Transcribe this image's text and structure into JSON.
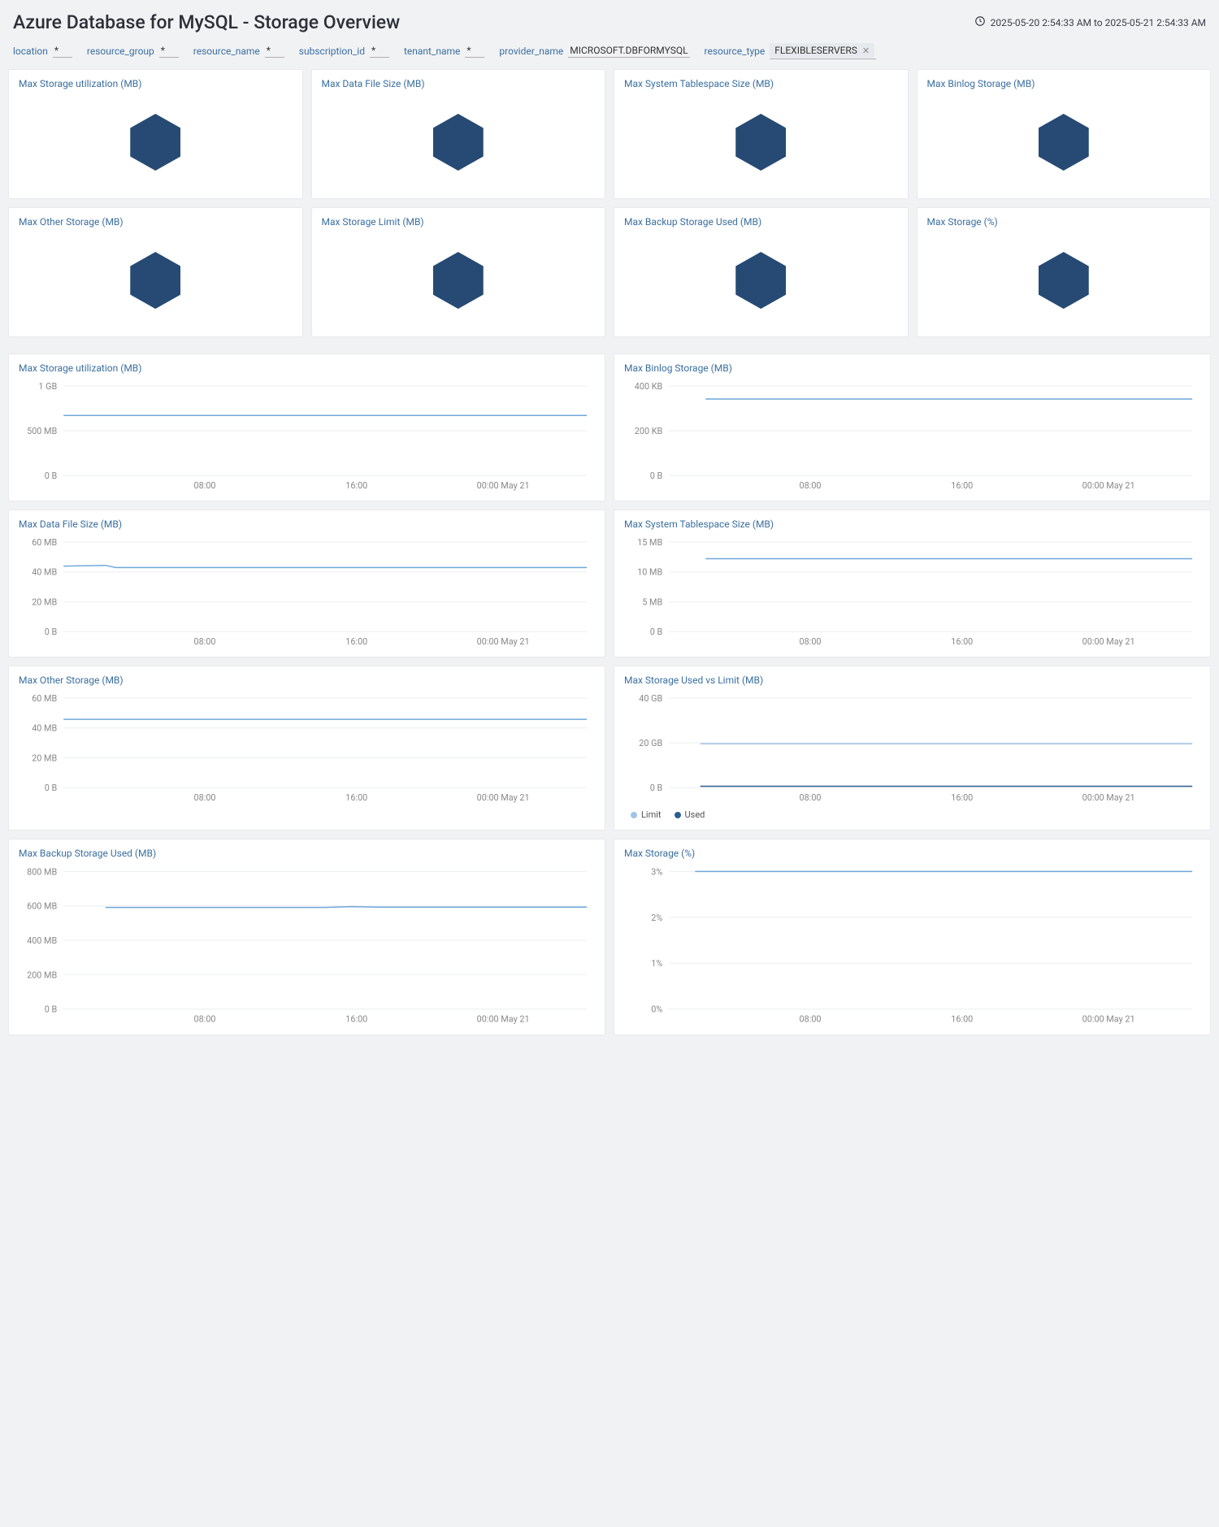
{
  "header": {
    "title": "Azure Database for MySQL - Storage Overview",
    "timerange": "2025-05-20 2:54:33 AM to 2025-05-21 2:54:33 AM"
  },
  "filters": {
    "location": {
      "label": "location",
      "value": "*"
    },
    "resource_group": {
      "label": "resource_group",
      "value": "*"
    },
    "resource_name": {
      "label": "resource_name",
      "value": "*"
    },
    "subscription_id": {
      "label": "subscription_id",
      "value": "*"
    },
    "tenant_name": {
      "label": "tenant_name",
      "value": "*"
    },
    "provider_name": {
      "label": "provider_name",
      "value": "MICROSOFT.DBFORMYSQL"
    },
    "resource_type": {
      "label": "resource_type",
      "chip": "FLEXIBLESERVERS"
    }
  },
  "tiles": [
    {
      "title": "Max Storage utilization (MB)"
    },
    {
      "title": "Max Data File Size (MB)"
    },
    {
      "title": "Max System Tablespace Size (MB)"
    },
    {
      "title": "Max Binlog Storage (MB)"
    },
    {
      "title": "Max Other Storage (MB)"
    },
    {
      "title": "Max Storage Limit (MB)"
    },
    {
      "title": "Max Backup Storage Used (MB)"
    },
    {
      "title": "Max Storage (%)"
    }
  ],
  "colors": {
    "line": "#6fa8dc",
    "limit": "#9fc5e8",
    "used": "#2d5e8f"
  },
  "chart_data": [
    {
      "id": "storage-util",
      "title": "Max Storage utilization (MB)",
      "type": "line",
      "y_ticks": [
        "1 GB",
        "500 MB",
        "0 B"
      ],
      "y_tick_fracs": [
        0,
        0.5,
        1
      ],
      "ylim": [
        0,
        1073741824
      ],
      "x_ticks": [
        "08:00",
        "16:00",
        "00:00 May 21"
      ],
      "series": [
        {
          "name": "Storage utilization",
          "color_key": "line",
          "x": [
            0,
            0.1,
            0.2,
            0.3,
            0.4,
            0.5,
            0.6,
            0.7,
            0.8,
            0.9,
            1.0
          ],
          "y": [
            720000000,
            720000000,
            720000000,
            720000000,
            720000000,
            720000000,
            720000000,
            720000000,
            720000000,
            720000000,
            720000000
          ]
        }
      ]
    },
    {
      "id": "binlog",
      "title": "Max Binlog Storage (MB)",
      "type": "line",
      "y_ticks": [
        "400 KB",
        "200 KB",
        "0 B"
      ],
      "y_tick_fracs": [
        0,
        0.5,
        1
      ],
      "ylim": [
        0,
        409600
      ],
      "x_ticks": [
        "08:00",
        "16:00",
        "00:00 May 21"
      ],
      "series": [
        {
          "name": "Binlog Storage",
          "color_key": "line",
          "x": [
            0.07,
            0.2,
            0.3,
            0.4,
            0.5,
            0.6,
            0.7,
            0.8,
            0.9,
            1.0
          ],
          "y": [
            350000,
            350000,
            350000,
            350000,
            350000,
            350000,
            350000,
            350000,
            350000,
            350000
          ]
        }
      ]
    },
    {
      "id": "datafile",
      "title": "Max Data File Size (MB)",
      "type": "line",
      "y_ticks": [
        "60 MB",
        "40 MB",
        "20 MB",
        "0 B"
      ],
      "y_tick_fracs": [
        0,
        0.3333,
        0.6666,
        1
      ],
      "ylim": [
        0,
        62914560
      ],
      "x_ticks": [
        "08:00",
        "16:00",
        "00:00 May 21"
      ],
      "series": [
        {
          "name": "Data File Size",
          "color_key": "line",
          "x": [
            0,
            0.08,
            0.1,
            0.2,
            0.3,
            0.4,
            0.5,
            0.6,
            0.7,
            0.8,
            0.9,
            1.0
          ],
          "y": [
            46000000,
            46500000,
            45000000,
            45000000,
            45000000,
            45000000,
            45000000,
            45000000,
            45000000,
            45000000,
            45000000,
            45000000
          ]
        }
      ]
    },
    {
      "id": "tablespace",
      "title": "Max System Tablespace Size (MB)",
      "type": "line",
      "y_ticks": [
        "15 MB",
        "10 MB",
        "5 MB",
        "0 B"
      ],
      "y_tick_fracs": [
        0,
        0.3333,
        0.6666,
        1
      ],
      "ylim": [
        0,
        15728640
      ],
      "x_ticks": [
        "08:00",
        "16:00",
        "00:00 May 21"
      ],
      "series": [
        {
          "name": "System Tablespace Size",
          "color_key": "line",
          "x": [
            0.07,
            0.2,
            0.3,
            0.4,
            0.5,
            0.6,
            0.7,
            0.8,
            0.9,
            1.0
          ],
          "y": [
            12800000,
            12800000,
            12800000,
            12800000,
            12800000,
            12800000,
            12800000,
            12800000,
            12800000,
            12800000
          ]
        }
      ]
    },
    {
      "id": "other",
      "title": "Max Other Storage (MB)",
      "type": "line",
      "y_ticks": [
        "60 MB",
        "40 MB",
        "20 MB",
        "0 B"
      ],
      "y_tick_fracs": [
        0,
        0.3333,
        0.6666,
        1
      ],
      "ylim": [
        0,
        62914560
      ],
      "x_ticks": [
        "08:00",
        "16:00",
        "00:00 May 21"
      ],
      "series": [
        {
          "name": "Other Storage",
          "color_key": "line",
          "x": [
            0,
            0.1,
            0.2,
            0.3,
            0.4,
            0.5,
            0.6,
            0.7,
            0.8,
            0.9,
            1.0
          ],
          "y": [
            48000000,
            48000000,
            48000000,
            48000000,
            48000000,
            48000000,
            48000000,
            48000000,
            48000000,
            48000000,
            48000000
          ]
        }
      ]
    },
    {
      "id": "used-vs-limit",
      "title": "Max Storage Used vs Limit (MB)",
      "type": "line",
      "y_ticks": [
        "40 GB",
        "20 GB",
        "0 B"
      ],
      "y_tick_fracs": [
        0,
        0.5,
        1
      ],
      "ylim": [
        0,
        42949672960
      ],
      "x_ticks": [
        "08:00",
        "16:00",
        "00:00 May 21"
      ],
      "legend": [
        {
          "name": "Limit",
          "color_key": "limit"
        },
        {
          "name": "Used",
          "color_key": "used"
        }
      ],
      "series": [
        {
          "name": "Limit",
          "color_key": "limit",
          "x": [
            0.06,
            0.2,
            0.3,
            0.4,
            0.5,
            0.6,
            0.7,
            0.8,
            0.9,
            1.0
          ],
          "y": [
            21000000000,
            21000000000,
            21000000000,
            21000000000,
            21000000000,
            21000000000,
            21000000000,
            21000000000,
            21000000000,
            21000000000
          ]
        },
        {
          "name": "Used",
          "color_key": "used",
          "x": [
            0.06,
            0.2,
            0.3,
            0.4,
            0.5,
            0.6,
            0.7,
            0.8,
            0.9,
            1.0
          ],
          "y": [
            700000000,
            700000000,
            700000000,
            700000000,
            700000000,
            700000000,
            700000000,
            700000000,
            700000000,
            700000000
          ]
        }
      ]
    },
    {
      "id": "backup",
      "title": "Max Backup Storage Used (MB)",
      "type": "line",
      "y_ticks": [
        "800 MB",
        "600 MB",
        "400 MB",
        "200 MB",
        "0 B"
      ],
      "y_tick_fracs": [
        0,
        0.25,
        0.5,
        0.75,
        1
      ],
      "ylim": [
        0,
        838860800
      ],
      "x_ticks": [
        "08:00",
        "16:00",
        "00:00 May 21"
      ],
      "series": [
        {
          "name": "Backup Storage Used",
          "color_key": "line",
          "x": [
            0.08,
            0.2,
            0.3,
            0.4,
            0.5,
            0.55,
            0.6,
            0.7,
            0.8,
            0.9,
            1.0
          ],
          "y": [
            620000000,
            620000000,
            620000000,
            620000000,
            620000000,
            625000000,
            622000000,
            622000000,
            622000000,
            622000000,
            622000000
          ]
        }
      ]
    },
    {
      "id": "storage-pct",
      "title": "Max Storage (%)",
      "type": "line",
      "y_ticks": [
        "3%",
        "2%",
        "1%",
        "0%"
      ],
      "y_tick_fracs": [
        0,
        0.3333,
        0.6666,
        1
      ],
      "ylim": [
        0,
        3
      ],
      "x_ticks": [
        "08:00",
        "16:00",
        "00:00 May 21"
      ],
      "series": [
        {
          "name": "Storage %",
          "color_key": "line",
          "x": [
            0.05,
            0.2,
            0.3,
            0.4,
            0.5,
            0.6,
            0.7,
            0.8,
            0.9,
            1.0
          ],
          "y": [
            3,
            3,
            3,
            3,
            3,
            3,
            3,
            3,
            3,
            3
          ]
        }
      ]
    }
  ]
}
